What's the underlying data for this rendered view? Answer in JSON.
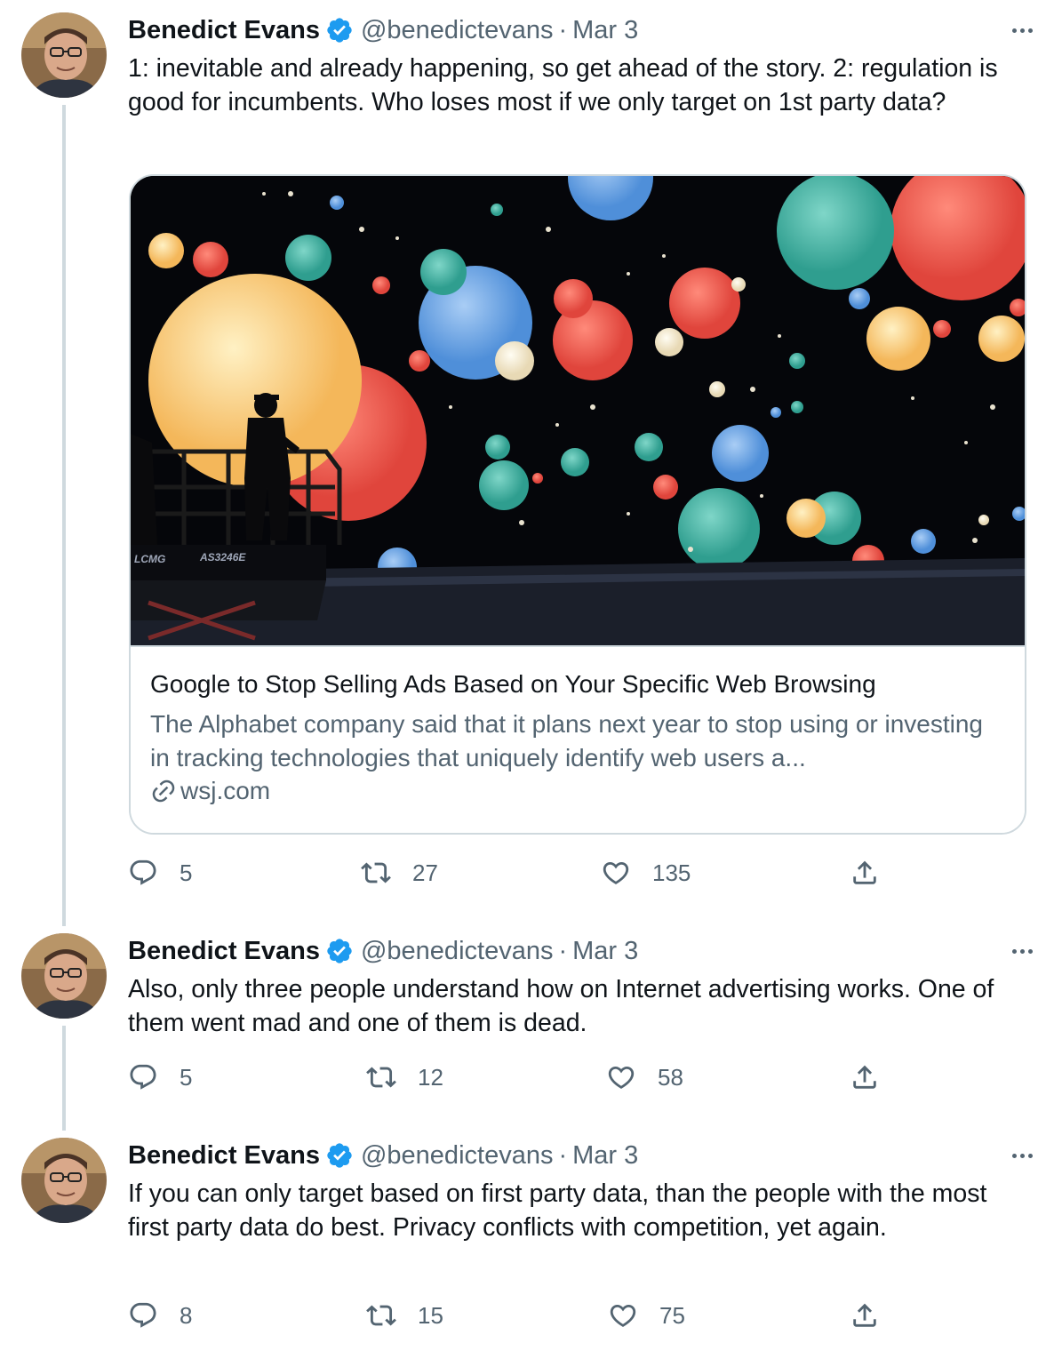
{
  "tweets": [
    {
      "author": {
        "name": "Benedict Evans",
        "handle": "@benedictevans",
        "verified": true
      },
      "separator": "·",
      "date": "Mar 3",
      "text": "1: inevitable and already happening, so get ahead of the story. 2: regulation is good for incumbents. Who loses most if we only target on 1st party data?",
      "card": {
        "title": "Google to Stop Selling Ads Based on Your Specific Web Browsing",
        "description": "The Alphabet company said that it plans next year to stop using or investing in tracking technologies that uniquely identify web users a...",
        "domain": "wsj.com",
        "image_text": [
          "LCMG",
          "AS3246E"
        ]
      },
      "stats": {
        "replies": "5",
        "retweets": "27",
        "likes": "135"
      }
    },
    {
      "author": {
        "name": "Benedict Evans",
        "handle": "@benedictevans",
        "verified": true
      },
      "separator": "·",
      "date": "Mar 3",
      "text": "Also, only three people understand how on Internet advertising works. One of them went mad and one of them is dead.",
      "stats": {
        "replies": "5",
        "retweets": "12",
        "likes": "58"
      }
    },
    {
      "author": {
        "name": "Benedict Evans",
        "handle": "@benedictevans",
        "verified": true
      },
      "separator": "·",
      "date": "Mar 3",
      "text": "If you can only target based on first party data, than the people with the most first party data do best. Privacy conflicts with competition, yet again.",
      "stats": {
        "replies": "8",
        "retweets": "15",
        "likes": "75"
      }
    }
  ],
  "colors": {
    "text": "#0f1419",
    "secondary": "#536471",
    "verified": "#1d9bf0",
    "border": "#cfd9de"
  },
  "icons": [
    "verified-badge-icon",
    "more-icon",
    "reply-icon",
    "retweet-icon",
    "like-icon",
    "share-icon",
    "link-icon"
  ]
}
